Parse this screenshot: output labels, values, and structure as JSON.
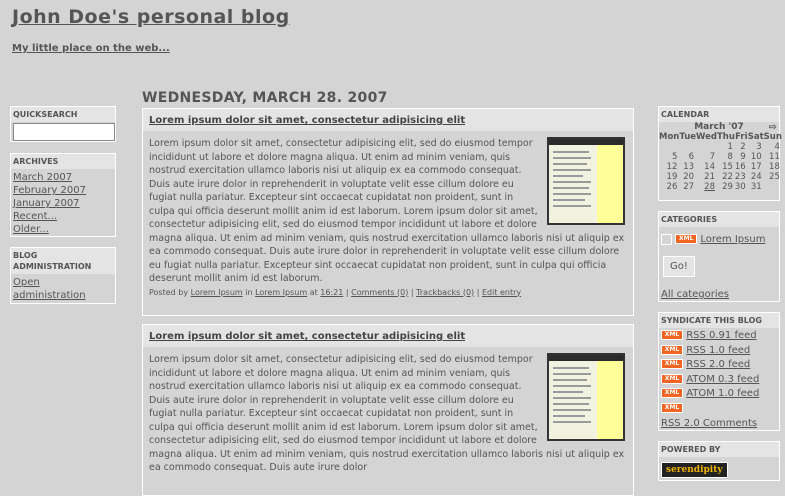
{
  "header": {
    "title": "John Doe's personal blog",
    "description": "My little place on the web..."
  },
  "quicksearch": {
    "title": "QUICKSEARCH",
    "value": ""
  },
  "archives": {
    "title": "ARCHIVES",
    "items": [
      "March 2007",
      "February 2007",
      "January 2007",
      "Recent...",
      "Older..."
    ]
  },
  "admin": {
    "title": "BLOG ADMINISTRATION",
    "link": "Open administration"
  },
  "date_header": "WEDNESDAY, MARCH 28. 2007",
  "entries": [
    {
      "title": "Lorem ipsum dolor sit amet, consectetur adipisicing elit",
      "body": "Lorem ipsum dolor sit amet, consectetur adipisicing elit, sed do eiusmod tempor incididunt ut labore et dolore magna aliqua. Ut enim ad minim veniam, quis nostrud exercitation ullamco laboris nisi ut aliquip ex ea commodo consequat. Duis aute irure dolor in reprehenderit in voluptate velit esse cillum dolore eu fugiat nulla pariatur. Excepteur sint occaecat cupidatat non proident, sunt in culpa qui officia deserunt mollit anim id est laborum. Lorem ipsum dolor sit amet, consectetur adipisicing elit, sed do eiusmod tempor incididunt ut labore et dolore magna aliqua. Ut enim ad minim veniam, quis nostrud exercitation ullamco laboris nisi ut aliquip ex ea commodo consequat. Duis aute irure dolor in reprehenderit in voluptate velit esse cillum dolore eu fugiat nulla pariatur. Excepteur sint occaecat cupidatat non proident, sunt in culpa qui officia deserunt mollit anim id est laborum.",
      "footer": {
        "posted_by": "Posted by",
        "author": "Lorem Ipsum",
        "in": "in",
        "category": "Lorem Ipsum",
        "at": "at",
        "time": "16:21",
        "comments": "Comments (0)",
        "trackbacks": "Trackbacks (0)",
        "edit": "Edit entry"
      }
    },
    {
      "title": "Lorem ipsum dolor sit amet, consectetur adipisicing elit",
      "body": "Lorem ipsum dolor sit amet, consectetur adipisicing elit, sed do eiusmod tempor incididunt ut labore et dolore magna aliqua. Ut enim ad minim veniam, quis nostrud exercitation ullamco laboris nisi ut aliquip ex ea commodo consequat. Duis aute irure dolor in reprehenderit in voluptate velit esse cillum dolore eu fugiat nulla pariatur. Excepteur sint occaecat cupidatat non proident, sunt in culpa qui officia deserunt mollit anim id est laborum. Lorem ipsum dolor sit amet, consectetur adipisicing elit, sed do eiusmod tempor incididunt ut labore et dolore magna aliqua. Ut enim ad minim veniam, quis nostrud exercitation ullamco laboris nisi ut aliquip ex ea commodo consequat. Duis aute irure dolor"
    }
  ],
  "calendar": {
    "title": "CALENDAR",
    "month": "March '07",
    "next_icon": "arrow-right-icon",
    "weekdays": [
      "Mon",
      "Tue",
      "Wed",
      "Thu",
      "Fri",
      "Sat",
      "Sun"
    ],
    "weeks": [
      [
        "",
        "",
        "",
        "1",
        "2",
        "3",
        "4"
      ],
      [
        "5",
        "6",
        "7",
        "8",
        "9",
        "10",
        "11"
      ],
      [
        "12",
        "13",
        "14",
        "15",
        "16",
        "17",
        "18"
      ],
      [
        "19",
        "20",
        "21",
        "22",
        "23",
        "24",
        "25"
      ],
      [
        "26",
        "27",
        "28",
        "29",
        "30",
        "31",
        ""
      ]
    ],
    "linked_day": "28"
  },
  "categories": {
    "title": "CATEGORIES",
    "item": "Lorem Ipsum",
    "xml_badge": "XML",
    "go_label": "Go!",
    "all_link": "All categories"
  },
  "syndicate": {
    "title": "SYNDICATE THIS BLOG",
    "xml_badge": "XML",
    "feeds": [
      "RSS 0.91 feed",
      "RSS 1.0 feed",
      "RSS 2.0 feed",
      "ATOM 0.3 feed",
      "ATOM 1.0 feed",
      ""
    ],
    "comments_link": "RSS 2.0 Comments"
  },
  "powered": {
    "title": "POWERED BY",
    "logo": "serendipity"
  },
  "colors": {
    "background": "#d4d4d4",
    "xml_badge": "#f26522",
    "thumb_sidebar": "#ffff99"
  }
}
